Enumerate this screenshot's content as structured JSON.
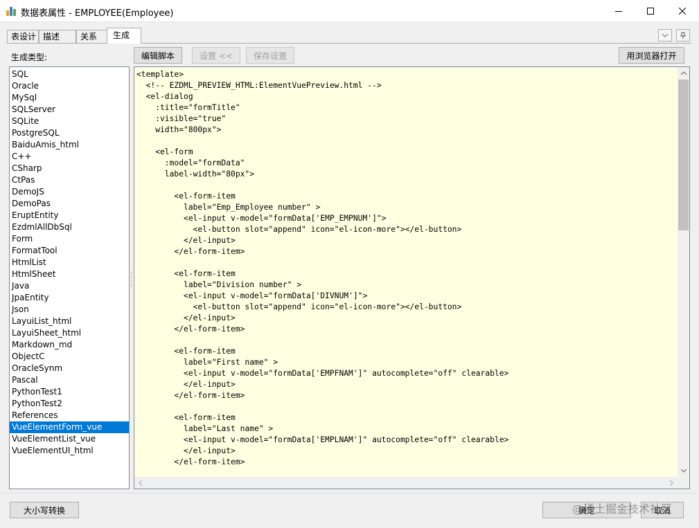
{
  "window": {
    "title": "数据表属性 - EMPLOYEE(Employee)",
    "icon": "table-app-icon"
  },
  "tabs": [
    {
      "label": "表设计"
    },
    {
      "label": "描述"
    },
    {
      "label": "关系"
    },
    {
      "label": "生成",
      "active": true
    }
  ],
  "generate": {
    "type_label": "生成类型:",
    "types": [
      "SQL",
      "Oracle",
      "MySql",
      "SQLServer",
      "SQLite",
      "PostgreSQL",
      "BaiduAmis_html",
      "C++",
      "CSharp",
      "CtPas",
      "DemoJS",
      "DemoPas",
      "EruptEntity",
      "EzdmlAllDbSql",
      "Form",
      "FormatTool",
      "HtmlList",
      "HtmlSheet",
      "Java",
      "JpaEntity",
      "Json",
      "LayuiList_html",
      "LayuiSheet_html",
      "Markdown_md",
      "ObjectC",
      "OracleSynm",
      "Pascal",
      "PythonTest1",
      "PythonTest2",
      "References",
      "VueElementForm_vue",
      "VueElementList_vue",
      "VueElementUI_html"
    ],
    "selected": "VueElementForm_vue"
  },
  "toolbar": {
    "edit_script": "编辑脚本",
    "settings": "设置 <<",
    "save_settings": "保存设置",
    "open_browser": "用浏览器打开"
  },
  "code": "<template>\n  <!-- EZDML_PREVIEW_HTML:ElementVuePreview.html -->\n  <el-dialog\n    :title=\"formTitle\"\n    :visible=\"true\"\n    width=\"800px\">\n\n    <el-form\n      :model=\"formData\"\n      label-width=\"80px\">\n\n        <el-form-item\n          label=\"Emp_Employee number\" >\n          <el-input v-model=\"formData['EMP_EMPNUM']\">\n            <el-button slot=\"append\" icon=\"el-icon-more\"></el-button>\n          </el-input>\n        </el-form-item>\n\n        <el-form-item\n          label=\"Division number\" >\n          <el-input v-model=\"formData['DIVNUM']\">\n            <el-button slot=\"append\" icon=\"el-icon-more\"></el-button>\n          </el-input>\n        </el-form-item>\n\n        <el-form-item\n          label=\"First name\" >\n          <el-input v-model=\"formData['EMPFNAM']\" autocomplete=\"off\" clearable>\n          </el-input>\n        </el-form-item>\n\n        <el-form-item\n          label=\"Last name\" >\n          <el-input v-model=\"formData['EMPLNAM']\" autocomplete=\"off\" clearable>\n          </el-input>\n        </el-form-item>\n",
  "footer": {
    "case_convert": "大小写转换",
    "ok": "确定",
    "cancel": "取消",
    "watermark": "@稀土掘金技术社区"
  },
  "colors": {
    "editor_bg": "#ffffe1",
    "selection": "#0078d7"
  }
}
